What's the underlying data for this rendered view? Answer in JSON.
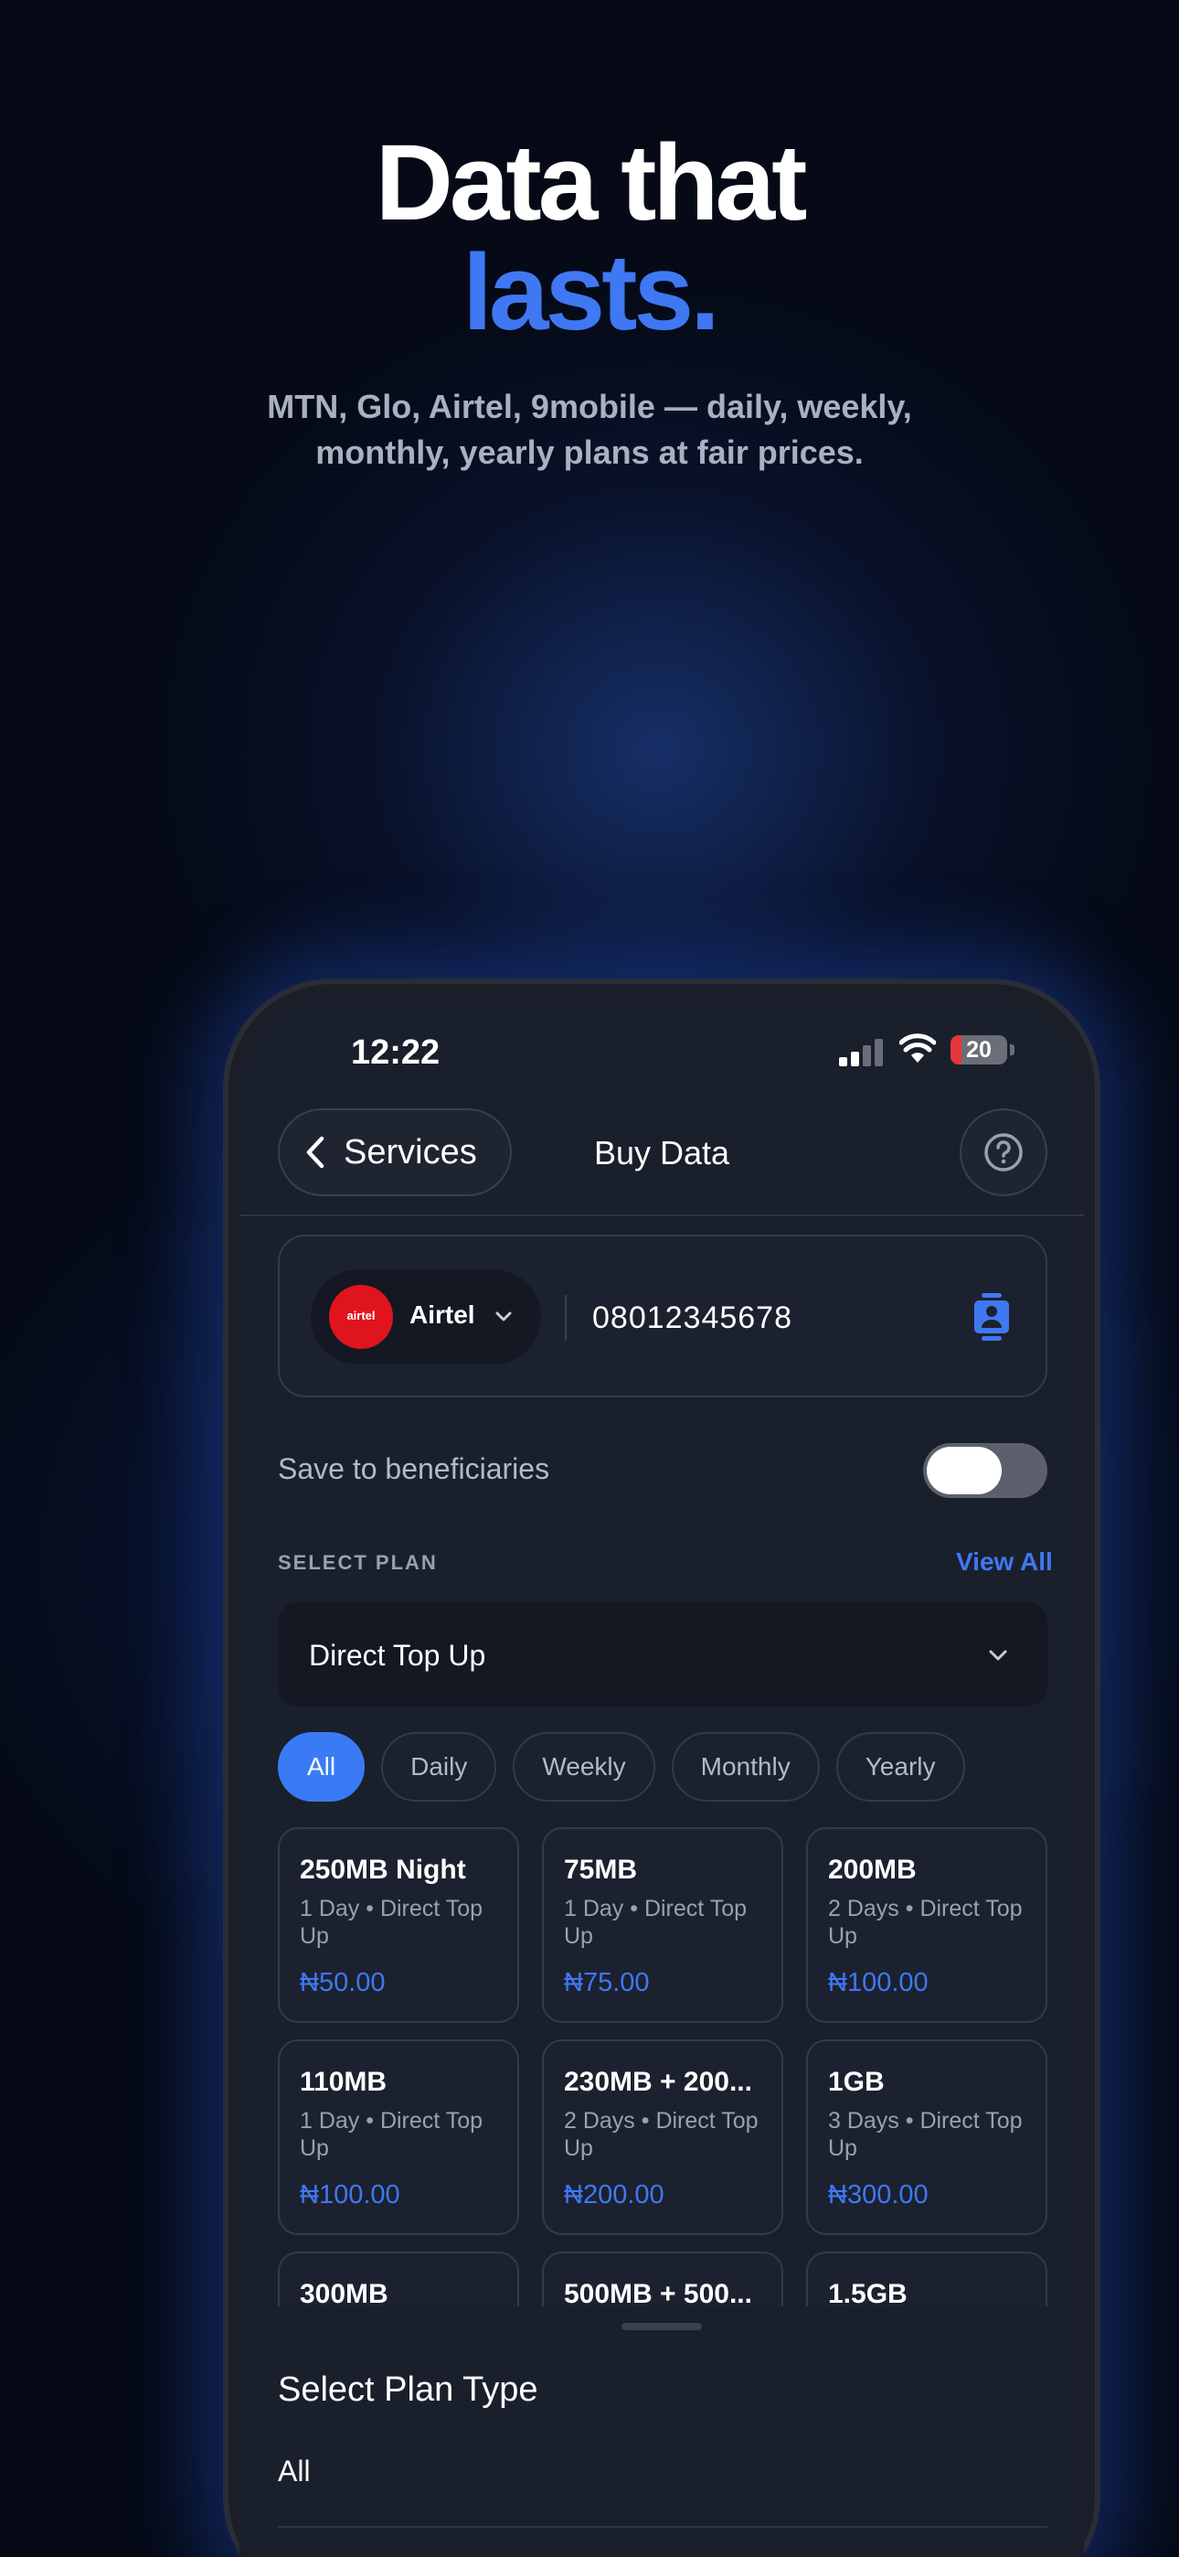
{
  "hero": {
    "line1": "Data that",
    "line2": "lasts.",
    "subtitle": "MTN, Glo, Airtel, 9mobile — daily, weekly, monthly, yearly plans at fair prices."
  },
  "status_bar": {
    "time": "12:22",
    "battery": "20",
    "battery_level": 0.2,
    "signal_bars": 2
  },
  "nav": {
    "back_label": "Services",
    "title": "Buy Data",
    "help_icon": "question-circle-icon"
  },
  "recipient": {
    "network": "Airtel",
    "logo_text": "airtel",
    "phone_number": "08012345678",
    "contact_icon": "contact-book-icon"
  },
  "save_beneficiary": {
    "label": "Save to beneficiaries",
    "enabled": false
  },
  "plan_section": {
    "label": "SELECT PLAN",
    "view_all": "View All",
    "selected_type": "Direct Top Up"
  },
  "tabs": [
    {
      "label": "All",
      "active": true
    },
    {
      "label": "Daily",
      "active": false
    },
    {
      "label": "Weekly",
      "active": false
    },
    {
      "label": "Monthly",
      "active": false
    },
    {
      "label": "Yearly",
      "active": false
    }
  ],
  "plans": [
    {
      "name": "250MB Night",
      "desc": "1 Day • Direct Top Up",
      "price": "₦50.00"
    },
    {
      "name": "75MB",
      "desc": "1 Day • Direct Top Up",
      "price": "₦75.00"
    },
    {
      "name": "200MB",
      "desc": "2 Days • Direct Top Up",
      "price": "₦100.00"
    },
    {
      "name": "110MB",
      "desc": "1 Day • Direct Top Up",
      "price": "₦100.00"
    },
    {
      "name": "230MB + 200...",
      "desc": "2 Days • Direct Top Up",
      "price": "₦200.00"
    },
    {
      "name": "1GB",
      "desc": "3 Days • Direct Top Up",
      "price": "₦300.00"
    },
    {
      "name": "300MB",
      "desc": "",
      "price": ""
    },
    {
      "name": "500MB + 500...",
      "desc": "",
      "price": ""
    },
    {
      "name": "1.5GB",
      "desc": "",
      "price": ""
    }
  ],
  "sheet": {
    "title": "Select Plan Type",
    "items": [
      "All"
    ]
  },
  "colors": {
    "accent": "#3f78f2",
    "background": "#050a16",
    "screen": "#1a1f2c",
    "airtel_red": "#e0141e"
  }
}
